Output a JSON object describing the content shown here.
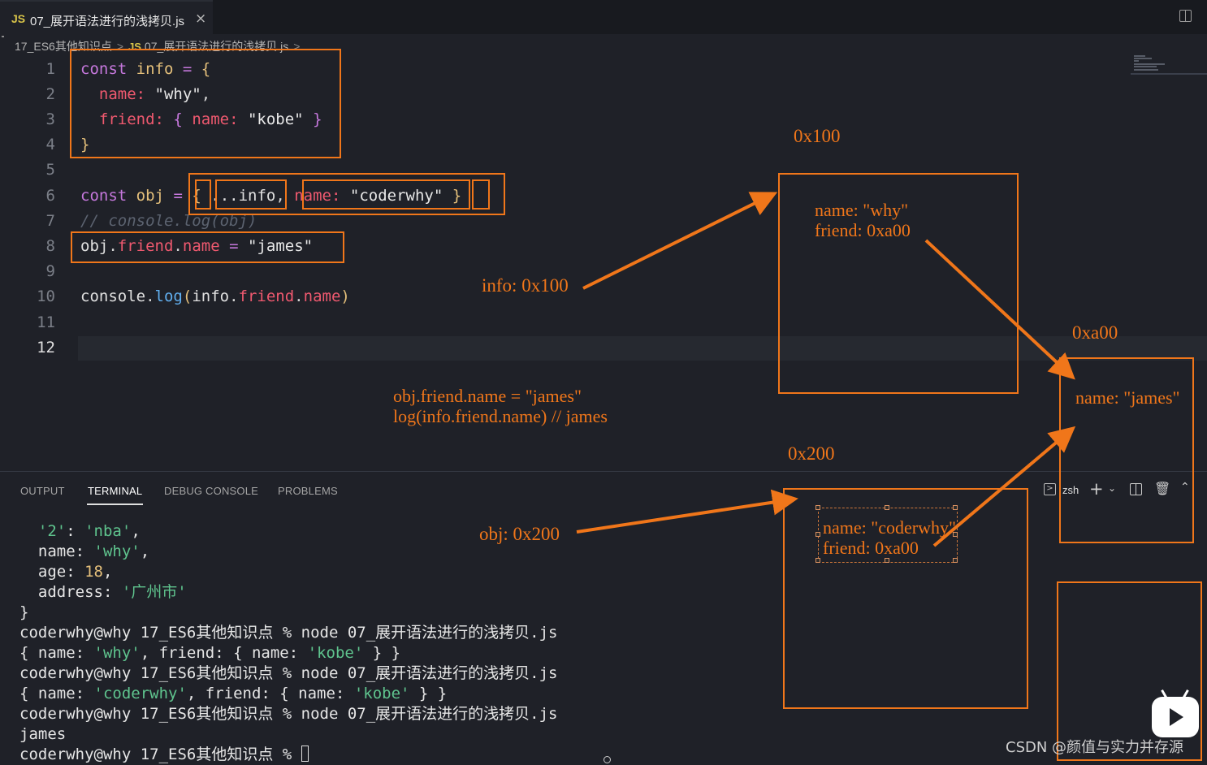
{
  "tab": {
    "lang_badge": "JS",
    "filename": "07_展开语法进行的浅拷贝.js",
    "close": "×"
  },
  "breadcrumb": {
    "folder": "17_ES6其他知识点",
    "sep": ">",
    "file_badge": "JS",
    "file": "07_展开语法进行的浅拷贝.js",
    "trail": ">"
  },
  "editor": {
    "line_numbers": [
      "1",
      "2",
      "3",
      "4",
      "5",
      "6",
      "7",
      "8",
      "9",
      "10",
      "11",
      "12"
    ],
    "active_line": "12",
    "code": {
      "l1": {
        "kw": "const",
        "name": "info",
        "eq": "=",
        "open": "{"
      },
      "l2": {
        "prop": "name:",
        "val": "\"why\"",
        "comma": ","
      },
      "l3": {
        "prop": "friend:",
        "open": "{",
        "prop2": "name:",
        "val": "\"kobe\"",
        "close": "}"
      },
      "l4": {
        "close": "}"
      },
      "l6": {
        "kw": "const",
        "name": "obj",
        "eq": "=",
        "open": "{",
        "spread": "...info",
        "comma": ",",
        "prop": "name:",
        "val": "\"coderwhy\"",
        "close": "}"
      },
      "l7": {
        "comment": "// console.log(obj)"
      },
      "l8": {
        "obj": "obj",
        "dot1": ".",
        "friend": "friend",
        "dot2": ".",
        "name": "name",
        "eq": "=",
        "val": "\"james\""
      },
      "l10": {
        "console": "console",
        "dot1": ".",
        "log": "log",
        "paren_open": "(",
        "info": "info",
        "dot2": ".",
        "friend": "friend",
        "dot3": ".",
        "name": "name",
        "paren_close": ")"
      }
    }
  },
  "panel": {
    "tabs": [
      "OUTPUT",
      "TERMINAL",
      "DEBUG CONSOLE",
      "PROBLEMS"
    ],
    "active_tab": "TERMINAL",
    "shell": "zsh",
    "terminal": {
      "l1": {
        "key": "'2'",
        "colon": ": ",
        "val": "'nba'",
        "end": ","
      },
      "l2": {
        "key": "name",
        "colon": ": ",
        "val": "'why'",
        "end": ","
      },
      "l3": {
        "key": "age",
        "colon": ": ",
        "val": "18",
        "end": ","
      },
      "l4": {
        "key": "address",
        "colon": ": ",
        "val": "'广州市'"
      },
      "l5": "}",
      "prompt": "coderwhy@why 17_ES6其他知识点 % node 07_展开语法进行的浅拷贝.js",
      "out1": {
        "a": "{ name: ",
        "v1": "'why'",
        "b": ", friend: { name: ",
        "v2": "'kobe'",
        "c": " } }"
      },
      "out2": {
        "a": "{ name: ",
        "v1": "'coderwhy'",
        "b": ", friend: { name: ",
        "v2": "'kobe'",
        "c": " } }"
      },
      "out3": "james",
      "last_prompt": "coderwhy@why 17_ES6其他知识点 % "
    }
  },
  "annotations": {
    "addr_100": "0x100",
    "addr_a00": "0xa00",
    "addr_200": "0x200",
    "info_ref": "info: 0x100",
    "obj_ref": "obj: 0x200",
    "mem100_l1": "name: \"why\"",
    "mem100_l2": "friend: 0xa00",
    "mema00_l1": "name: \"james\"",
    "mem200_l1": "name: \"coderwhy\"",
    "mem200_l2": "friend: 0xa00",
    "note_l1": "obj.friend.name = \"james\"",
    "note_l2": "log(info.friend.name) // james",
    "accent_color": "#f0761a"
  },
  "watermark": {
    "text": "CSDN @颜值与实力并存源"
  }
}
